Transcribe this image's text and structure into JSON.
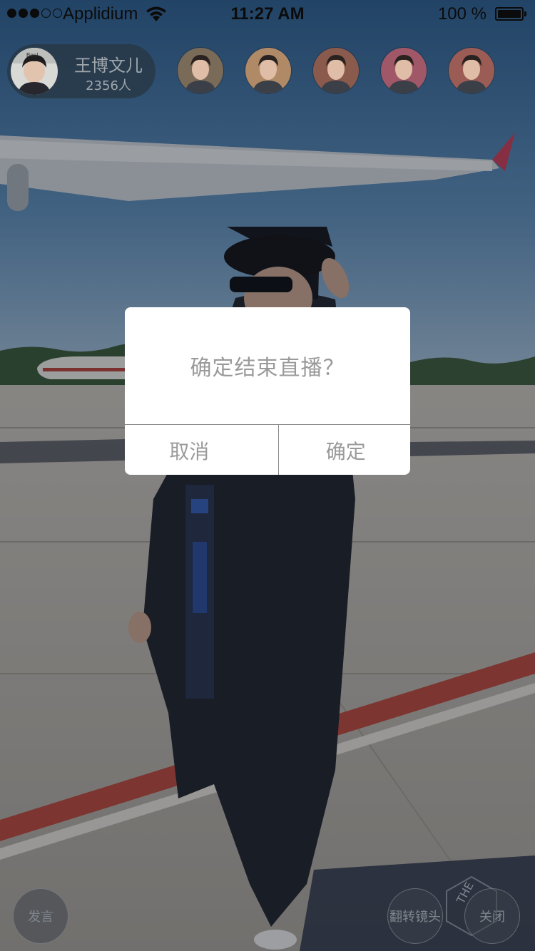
{
  "status_bar": {
    "carrier": "Applidium",
    "time": "11:27 AM",
    "battery_percent": "100 %",
    "signal_bars_filled": 3,
    "signal_bars_total": 5,
    "battery_level": 1.0,
    "icons": [
      "signal-dots",
      "wifi-icon",
      "battery-icon"
    ]
  },
  "host": {
    "name": "王博文儿",
    "viewers": "2356人",
    "avatar_text": "Boo!"
  },
  "viewers": [
    {
      "name": "viewer-1",
      "tone": "#7a6a58"
    },
    {
      "name": "viewer-2",
      "tone": "#b08a66"
    },
    {
      "name": "viewer-3",
      "tone": "#8a5a4c"
    },
    {
      "name": "viewer-4",
      "tone": "#a05868"
    },
    {
      "name": "viewer-5",
      "tone": "#9b5c55"
    }
  ],
  "dialog": {
    "message": "确定结束直播？",
    "cancel_label": "取消",
    "confirm_label": "确定"
  },
  "bottom_bar": {
    "speak_label": "发言",
    "flip_camera_label": "翻转镜头",
    "close_label": "关闭",
    "watermark_text": "THE"
  },
  "colors": {
    "dialog_background": "#ffffff",
    "dialog_text": "#9a9a9a",
    "divider": "#8a8a8a",
    "host_pill": "#283846",
    "sky": "#4a77a6",
    "tarmac": "#b9b3ab",
    "runway_stripe": "#b44a3e"
  }
}
